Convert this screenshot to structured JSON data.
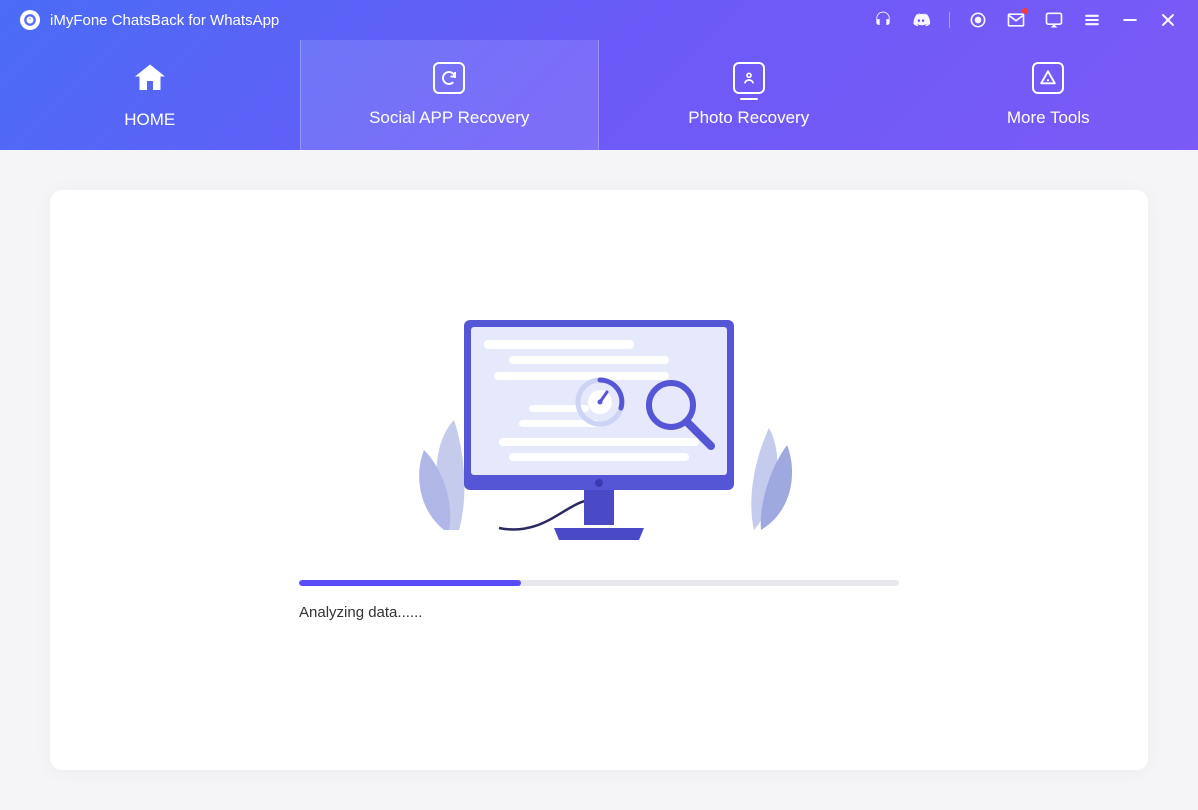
{
  "app": {
    "title": "iMyFone ChatsBack for WhatsApp"
  },
  "nav": {
    "items": [
      {
        "label": "HOME"
      },
      {
        "label": "Social APP Recovery"
      },
      {
        "label": "Photo Recovery"
      },
      {
        "label": "More Tools"
      }
    ],
    "activeIndex": 1
  },
  "progress": {
    "percent": 37,
    "label": "Analyzing data......"
  },
  "colors": {
    "primary": "#5a4cf7",
    "gradientStart": "#4a6cf7",
    "gradientEnd": "#7b5af7"
  }
}
